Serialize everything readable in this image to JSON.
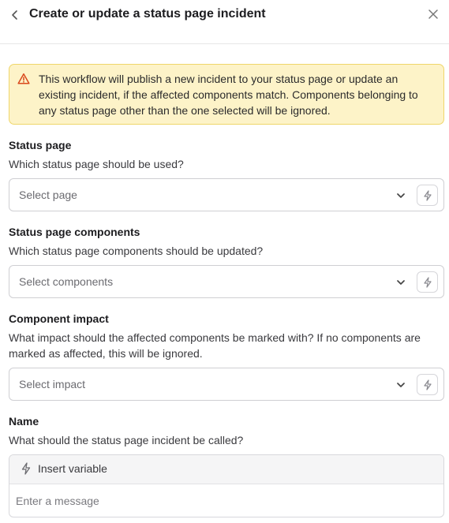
{
  "header": {
    "title": "Create or update a status page incident",
    "back_icon": "chevron-left-icon",
    "close_icon": "close-icon"
  },
  "warning": {
    "icon": "warning-triangle-icon",
    "text": "This workflow will publish a new incident to your status page or update an existing incident, if the affected components match. Components belonging to any status page other than the one selected will be ignored.",
    "colors": {
      "background": "#fdf3c8",
      "border": "#efd66a",
      "icon": "#d9481c"
    }
  },
  "fields": {
    "status_page": {
      "label": "Status page",
      "help": "Which status page should be used?",
      "placeholder": "Select page"
    },
    "components": {
      "label": "Status page components",
      "help": "Which status page components should be updated?",
      "placeholder": "Select components"
    },
    "impact": {
      "label": "Component impact",
      "help": "What impact should the affected components be marked with? If no components are marked as affected, this will be ignored.",
      "placeholder": "Select impact"
    },
    "name": {
      "label": "Name",
      "help": "What should the status page incident be called?",
      "insert_variable": "Insert variable",
      "placeholder": "Enter a message"
    }
  }
}
